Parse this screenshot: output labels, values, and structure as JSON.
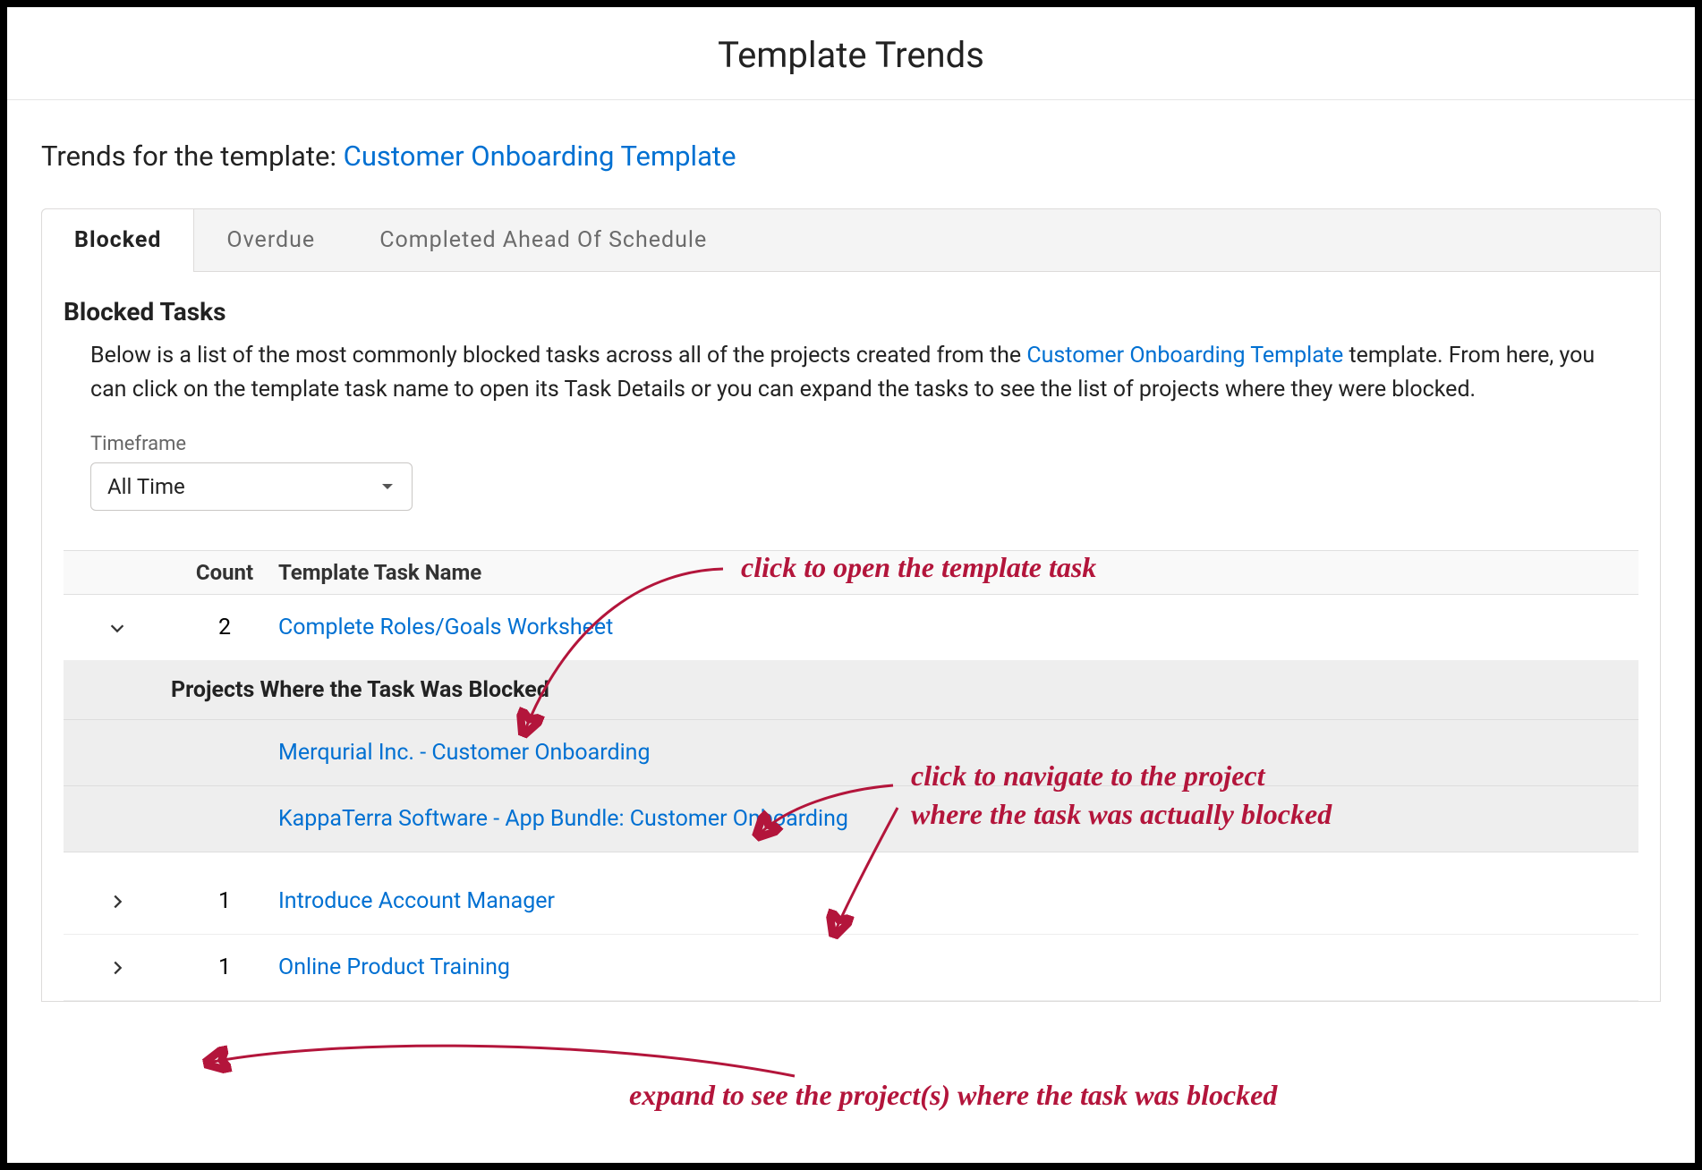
{
  "page_title": "Template Trends",
  "trends_prefix": "Trends for the template: ",
  "template_name": "Customer Onboarding Template",
  "tabs": [
    {
      "label": "Blocked",
      "active": true
    },
    {
      "label": "Overdue",
      "active": false
    },
    {
      "label": "Completed Ahead Of Schedule",
      "active": false
    }
  ],
  "section": {
    "title": "Blocked Tasks",
    "desc_before": "Below is a list of the most commonly blocked tasks across all of the projects created from the ",
    "desc_link": "Customer Onboarding Template",
    "desc_after": " template. From here, you can click on the template task name to open its Task Details or you can expand the tasks to see the list of projects where they were blocked."
  },
  "timeframe": {
    "label": "Timeframe",
    "value": "All Time"
  },
  "columns": {
    "count": "Count",
    "task_name": "Template Task Name"
  },
  "rows": [
    {
      "expanded": true,
      "count": 2,
      "task_name": "Complete Roles/Goals Worksheet",
      "projects_header": "Projects Where the Task Was Blocked",
      "projects": [
        "Merqurial Inc. - Customer Onboarding",
        "KappaTerra Software - App Bundle: Customer Onboarding"
      ]
    },
    {
      "expanded": false,
      "count": 1,
      "task_name": "Introduce Account Manager"
    },
    {
      "expanded": false,
      "count": 1,
      "task_name": "Online Product Training"
    }
  ],
  "annotations": {
    "a1": "click to open the template task",
    "a2_line1": "click to navigate to the project",
    "a2_line2": "where the task was actually blocked",
    "a3": "expand to see the project(s) where the task was blocked"
  }
}
